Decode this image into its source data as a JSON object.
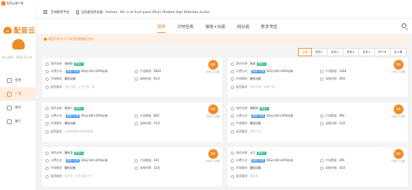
{
  "window": {
    "title": "配音云客户端"
  },
  "topbar": {
    "channel": "在线配音平台",
    "device": "当前麦克风设备：Default - Mic in at front panel (Pink) (Realtek High Definition Audio)"
  },
  "sidebar": {
    "logo_text": "配音云",
    "joined": "加入时间：2022-12-19",
    "items": [
      {
        "label": "任务",
        "icon": "task-icon"
      },
      {
        "label": "广播",
        "icon": "broadcast-icon"
      },
      {
        "label": "统计",
        "icon": "stats-icon"
      },
      {
        "label": "账户",
        "icon": "account-icon"
      }
    ],
    "active_index": 1
  },
  "tabs": [
    "推荐",
    "计时任务",
    "保底+分成",
    "纯分成",
    "新手专区"
  ],
  "active_tab": 0,
  "notice": "截至月21日 11:18日检测更新日合计",
  "filters": [
    "全部",
    "男成人",
    "女成人",
    "男老人",
    "女老人",
    "男少年",
    "女儿童"
  ],
  "active_filter": 0,
  "cards": [
    {
      "role_label": "角色名称：",
      "role": "张伯伯",
      "tag": "男成人",
      "tag_color": "green",
      "pay_label": "计费方式：",
      "pay_badge": "保底+分成",
      "pay": "20元/小时+20%分成",
      "period_label": "环境需求：",
      "period": "最低设备",
      "req_label": "配音要求：",
      "req": "音色沉稳，大气正直一致",
      "count_label": "片段数量：",
      "count": "4624",
      "days_label": "录制时限：",
      "days": "61天",
      "stamp": "招募",
      "stamp_count": "已有1人试音"
    },
    {
      "role_label": "角色名称：",
      "role": "老虎",
      "tag": "男成人",
      "tag_color": "green",
      "pay_label": "计费方式：",
      "pay_badge": "保底+分成",
      "pay": "20元/小时+20%分成",
      "period_label": "环境需求：",
      "period": "最低设备",
      "req_label": "配音要求：",
      "req": "声音浑厚，有威严感",
      "count_label": "片段数量：",
      "count": "1316",
      "days_label": "录制时限：",
      "days": "16天",
      "stamp": "招募",
      "stamp_count": "已有1人试音"
    },
    {
      "role_label": "角色名称：",
      "role": "男成人",
      "tag": "男成人",
      "tag_color": "green",
      "pay_label": "计费方式：",
      "pay_badge": "保底+分成",
      "pay": "20元/小时+20%分成",
      "period_label": "环境需求：",
      "period": "最低设备",
      "req_label": "配音要求：",
      "req": "自然MNM声音成熟稳重",
      "count_label": "片段数量：",
      "count": "825",
      "days_label": "录制时限：",
      "days": "11天",
      "stamp": "招募",
      "stamp_count": "已有1人试音"
    },
    {
      "role_label": "角色名称：",
      "role": "周斯年",
      "tag": "男成人",
      "tag_color": "green",
      "pay_label": "计费方式：",
      "pay_badge": "保底+分成",
      "pay": "20元/小时+20%分成",
      "period_label": "环境需求：",
      "period": "最低设备",
      "req_label": "配音要求：",
      "req": "音色干净",
      "count_label": "片段数量：",
      "count": "492",
      "days_label": "录制时限：",
      "days": "12天",
      "stamp": "招募",
      "stamp_count": "已有1人试音"
    },
    {
      "role_label": "角色名称：",
      "role": "魏金龙",
      "tag": "男成人",
      "tag_color": "green",
      "pay_label": "计费方式：",
      "pay_badge": "保底+分成",
      "pay": "20元/小时+20%分成",
      "period_label": "环境需求：",
      "period": "最低设备",
      "req_label": "配音要求：",
      "req": "男中音，声音沉稳大气",
      "count_label": "片段数量：",
      "count": "431",
      "days_label": "录制时限：",
      "days": "12天",
      "stamp": "招募",
      "stamp_count": "已有1人试音"
    },
    {
      "role_label": "角色名称：",
      "role": "沙六",
      "tag": "男成人",
      "tag_color": "green",
      "pay_label": "计费方式：",
      "pay_badge": "保底+分成",
      "pay": "20元/小时+20%分成",
      "period_label": "环境需求：",
      "period": "最低设备",
      "req_label": "配音要求：",
      "req": "青年音",
      "count_label": "片段数量：",
      "count": "295",
      "days_label": "录制时限：",
      "days": "12天",
      "stamp": "招募",
      "stamp_count": "已有1人试音"
    }
  ]
}
